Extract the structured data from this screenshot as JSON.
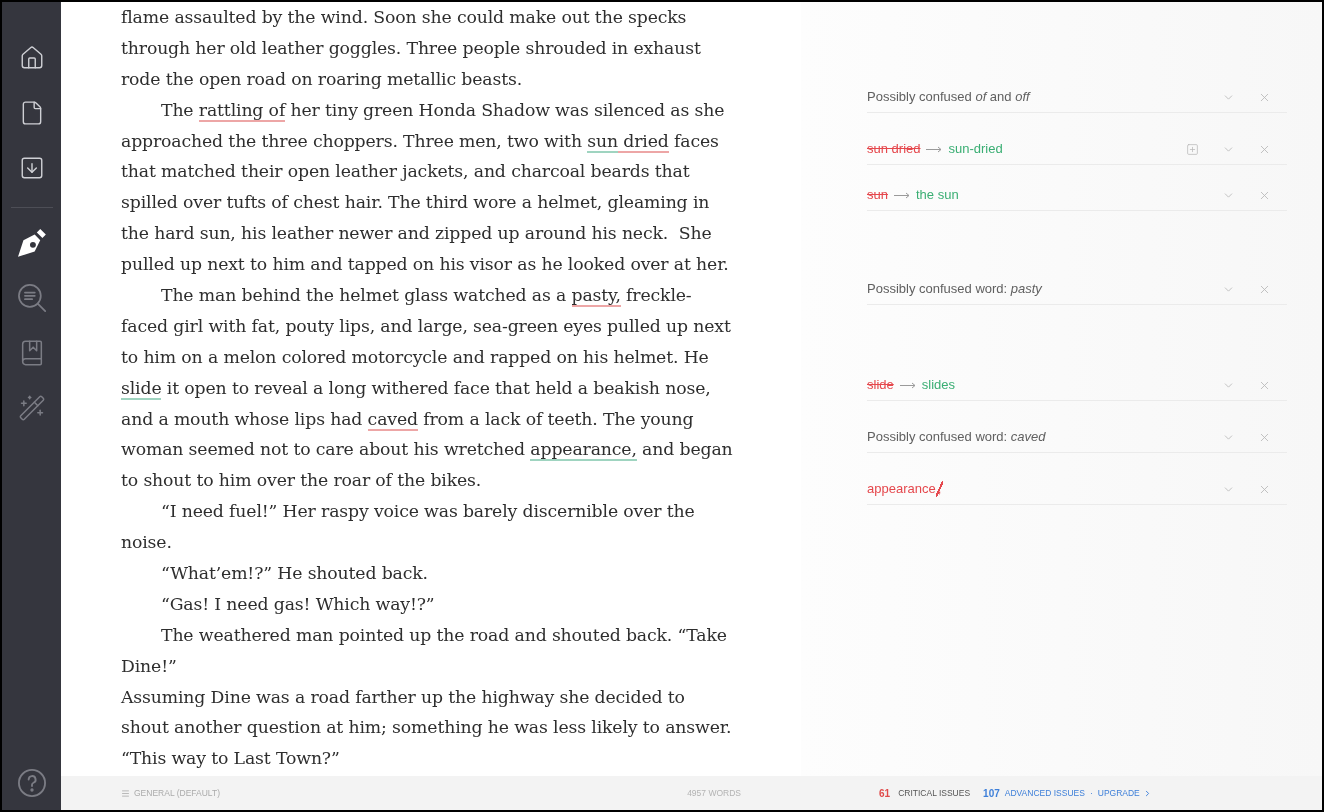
{
  "sidebar": {
    "tools": [
      {
        "selected": true
      },
      {
        "selected": false
      },
      {
        "selected": false
      },
      {
        "selected": false
      }
    ]
  },
  "document": {
    "paragraphs": [
      {
        "indented": false,
        "lines": [
          [
            "flame assaulted by the wind. Soon she could make out the specks"
          ],
          [
            "through her old leather goggles. Three people shrouded in exhaust"
          ],
          [
            "rode the open road on roaring metallic beasts."
          ]
        ]
      },
      {
        "indented": true,
        "lines": [
          [
            "The ",
            {
              "text": "rattling of",
              "color": "#eda6a6"
            },
            " her tiny green Honda Shadow was silenced as she"
          ],
          [
            "approached the three choppers. Three men, two with ",
            {
              "text": "sun",
              "color": "#9fd4c0"
            },
            {
              "text": " dried",
              "color": "#eda6a6"
            },
            " faces"
          ],
          [
            "that matched their open leather jackets, and charcoal beards that"
          ],
          [
            "spilled over tufts of chest hair. The third wore a helmet, gleaming in"
          ],
          [
            "the hard sun, his leather newer and zipped up around his neck.  She"
          ],
          [
            "pulled up next to him and tapped on his visor as he looked over at her."
          ]
        ]
      },
      {
        "indented": true,
        "lines": [
          [
            "The man behind the helmet glass watched as a ",
            {
              "text": "pasty,",
              "color": "#eda6a6"
            },
            " freckle-"
          ],
          [
            "faced girl with fat, pouty lips, and large, sea-green eyes pulled up next"
          ],
          [
            "to him on a melon colored motorcycle and rapped on his helmet. He"
          ],
          [
            {
              "text": "slide",
              "color": "#9fd4c0"
            },
            " it open to reveal a long withered face that held a beakish nose,"
          ],
          [
            "and a mouth whose lips had ",
            {
              "text": "caved",
              "color": "#eda6a6"
            },
            " from a lack of teeth. The young"
          ],
          [
            "woman seemed not to care about his wretched ",
            {
              "text": "appearance,",
              "color": "#9fd4c0"
            },
            " and began"
          ],
          [
            "to shout to him over the roar of the bikes."
          ]
        ]
      },
      {
        "indented": true,
        "lines": [
          [
            "“I need fuel!” Her raspy voice was barely discernible over the"
          ],
          [
            "noise."
          ]
        ]
      },
      {
        "indented": true,
        "lines": [
          [
            "“What’em!?” He shouted back."
          ]
        ]
      },
      {
        "indented": true,
        "lines": [
          [
            "“Gas! I need gas! Which way!?”"
          ]
        ]
      },
      {
        "indented": true,
        "lines": [
          [
            "The weathered man pointed up the road and shouted back. “Take"
          ],
          [
            "Dine!”"
          ]
        ]
      },
      {
        "indented": false,
        "lines": [
          [
            "Assuming Dine was a road farther up the highway she decided to"
          ],
          [
            "shout another question at him; something he was less likely to answer."
          ]
        ]
      },
      {
        "indented": false,
        "lines": [
          [
            "“This way to Last Town?”"
          ]
        ]
      }
    ]
  },
  "issues": [
    {
      "kind": "confused",
      "text": "Possibly confused *of* and *off*",
      "can_add": false
    },
    {
      "kind": "replace",
      "from": "sun dried",
      "to": "sun-dried",
      "can_add": true
    },
    {
      "kind": "replace",
      "from": "sun",
      "to": "the sun",
      "can_add": false
    },
    {
      "kind": "confused",
      "text": "Possibly confused word: *pasty*",
      "can_add": false
    },
    {
      "kind": "replace",
      "from": "slide",
      "to": "slides",
      "can_add": false
    },
    {
      "kind": "confused",
      "text": "Possibly confused word: *caved*",
      "can_add": false
    },
    {
      "kind": "remove",
      "word": "appearance",
      "removed": ",",
      "can_add": false
    }
  ],
  "status_bar": {
    "style": "GENERAL (DEFAULT)",
    "word_count": "4957 WORDS",
    "critical_count": "61",
    "critical_label": "CRITICAL ISSUES",
    "advanced_count": "107",
    "advanced_label": "ADVANCED ISSUES",
    "separator": "·",
    "upgrade": "UPGRADE"
  }
}
